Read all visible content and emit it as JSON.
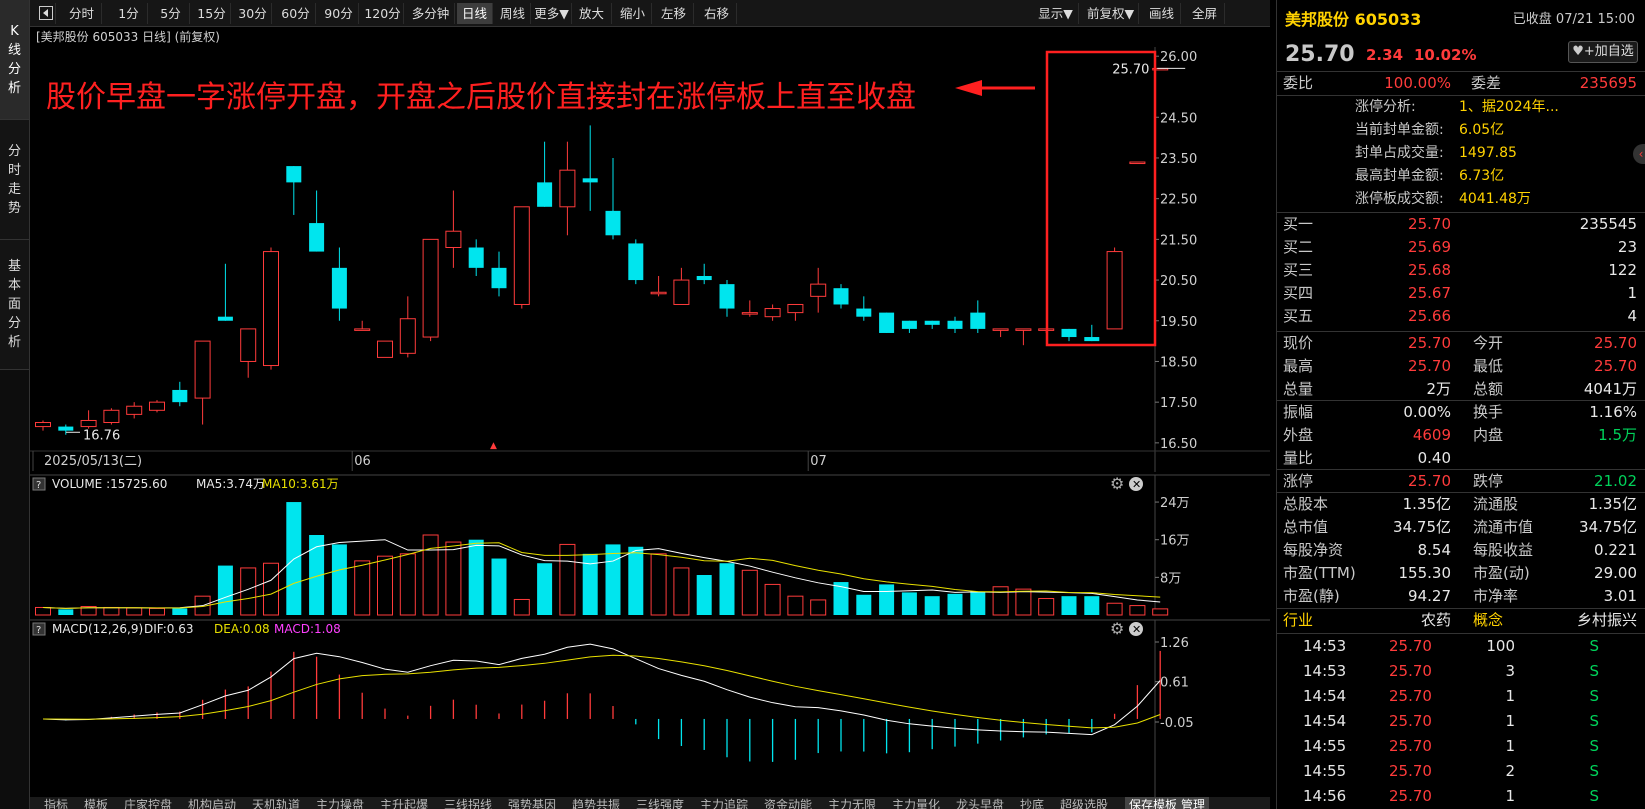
{
  "leftnav": [
    {
      "label": "K线分析",
      "active": true
    },
    {
      "label": "分时走势",
      "active": false
    },
    {
      "label": "基本面分析",
      "active": false
    }
  ],
  "toolbar": {
    "items": [
      "分时",
      "1分",
      "5分",
      "15分",
      "30分",
      "60分",
      "90分",
      "120分",
      "多分钟",
      "日线",
      "周线",
      "更多▼",
      "放大",
      "缩小",
      "左移",
      "右移"
    ],
    "active": "日线",
    "right_items": [
      "显示▼",
      "前复权▼",
      "画线",
      "全屏"
    ]
  },
  "chart_header": "[美邦股份 605033 日线] (前复权)",
  "annotation": "股价早盘一字涨停开盘，开盘之后股价直接封在涨停板上直至收盘",
  "chart_data": {
    "type": "candlestick",
    "price_axis": [
      "26.00",
      "24.50",
      "23.50",
      "22.50",
      "21.50",
      "20.50",
      "19.50",
      "18.50",
      "17.50",
      "16.50"
    ],
    "ylim": [
      16.3,
      26.3
    ],
    "date_labels": [
      {
        "i": 0,
        "text": "2025/05/13(二)"
      },
      {
        "i": 14,
        "text": "06"
      },
      {
        "i": 34,
        "text": "07"
      }
    ],
    "candles": [
      [
        16.9,
        17.0,
        16.8,
        17.05
      ],
      [
        16.9,
        16.8,
        16.7,
        16.95
      ],
      [
        16.9,
        17.05,
        16.85,
        17.3
      ],
      [
        17.0,
        17.3,
        16.95,
        17.35
      ],
      [
        17.2,
        17.4,
        17.1,
        17.5
      ],
      [
        17.3,
        17.5,
        17.25,
        17.55
      ],
      [
        17.8,
        17.5,
        17.4,
        18.0
      ],
      [
        17.6,
        19.0,
        16.95,
        19.0
      ],
      [
        19.6,
        19.5,
        19.5,
        20.9
      ],
      [
        18.5,
        19.3,
        18.1,
        19.3
      ],
      [
        18.4,
        21.2,
        18.3,
        21.3
      ],
      [
        23.3,
        22.9,
        22.1,
        23.3
      ],
      [
        21.9,
        21.2,
        21.2,
        22.7
      ],
      [
        20.8,
        19.8,
        19.5,
        21.3
      ],
      [
        19.3,
        19.3,
        19.3,
        19.5
      ],
      [
        18.6,
        19.0,
        18.6,
        19.0
      ],
      [
        18.7,
        19.55,
        18.6,
        20.1
      ],
      [
        19.1,
        21.5,
        19.0,
        21.5
      ],
      [
        21.3,
        21.7,
        20.8,
        22.7
      ],
      [
        21.3,
        20.8,
        20.6,
        21.5
      ],
      [
        20.8,
        20.3,
        20.1,
        21.2
      ],
      [
        19.9,
        22.3,
        19.8,
        22.3
      ],
      [
        22.9,
        22.3,
        22.3,
        23.9
      ],
      [
        22.3,
        23.2,
        21.6,
        23.9
      ],
      [
        23.0,
        22.9,
        22.2,
        24.3
      ],
      [
        22.2,
        21.6,
        21.5,
        23.5
      ],
      [
        21.4,
        20.5,
        20.4,
        21.5
      ],
      [
        20.2,
        20.2,
        20.1,
        20.6
      ],
      [
        19.9,
        20.5,
        19.9,
        20.8
      ],
      [
        20.6,
        20.5,
        20.4,
        20.9
      ],
      [
        20.4,
        19.8,
        19.6,
        20.5
      ],
      [
        19.7,
        19.7,
        19.6,
        20.0
      ],
      [
        19.6,
        19.8,
        19.5,
        19.9
      ],
      [
        19.7,
        19.9,
        19.5,
        19.9
      ],
      [
        20.1,
        20.4,
        19.7,
        20.8
      ],
      [
        20.3,
        19.9,
        19.8,
        20.4
      ],
      [
        19.8,
        19.6,
        19.5,
        20.1
      ],
      [
        19.7,
        19.2,
        19.2,
        19.7
      ],
      [
        19.5,
        19.3,
        19.2,
        19.5
      ],
      [
        19.5,
        19.4,
        19.3,
        19.5
      ],
      [
        19.5,
        19.3,
        19.2,
        19.6
      ],
      [
        19.7,
        19.3,
        19.2,
        20.0
      ],
      [
        19.3,
        19.3,
        19.1,
        19.3
      ],
      [
        19.3,
        19.3,
        18.9,
        19.3
      ],
      [
        19.3,
        19.3,
        19.2,
        19.3
      ],
      [
        19.3,
        19.1,
        19.0,
        19.3
      ],
      [
        19.1,
        19.0,
        19.0,
        19.4
      ],
      [
        19.3,
        21.2,
        19.3,
        21.3
      ],
      [
        23.4,
        23.4,
        23.4,
        23.4
      ],
      [
        25.7,
        25.7,
        25.7,
        25.7
      ]
    ],
    "last_price_label": "25.70",
    "low_label": "16.76",
    "volume": {
      "title": "VOLUME",
      "values_text": ":15725.60",
      "ma5_text": "MA5:3.74万",
      "ma10_text": "MA10:3.61万",
      "axis": [
        "24万",
        "16万",
        "8万"
      ],
      "max": 25.5,
      "bars": [
        1.6,
        1.2,
        1.8,
        1.6,
        1.5,
        1.4,
        1.4,
        4.0,
        10.5,
        10.0,
        11.0,
        24.0,
        17.0,
        15.0,
        11.5,
        12.5,
        13.0,
        17.0,
        15.5,
        16.0,
        12.0,
        3.3,
        11.0,
        15.0,
        13.0,
        15.0,
        14.5,
        13.0,
        10.0,
        8.5,
        11.0,
        9.5,
        6.5,
        4.0,
        3.2,
        7.0,
        4.3,
        6.5,
        4.8,
        4.0,
        4.5,
        4.8,
        6.0,
        5.5,
        3.5,
        4.0,
        4.0,
        2.5,
        2.0,
        1.3
      ]
    },
    "macd": {
      "title": "MACD(12,26,9)",
      "dif_text": "DIF:0.63",
      "dea_text": "DEA:0.08",
      "macd_text": "MACD:1.08",
      "axis": [
        "1.26",
        "0.61",
        "-0.05"
      ]
    }
  },
  "colors": {
    "up": "#ff3b3b",
    "down": "#00e5ee",
    "ma5": "#ffffff",
    "ma10": "#e8e000",
    "macd_pos": "#ff3b3b",
    "macd_neg": "#00e5ee"
  },
  "right": {
    "name_code": "美邦股份 605033",
    "status": "已收盘 07/21 15:00",
    "price": "25.70",
    "change": "2.34",
    "pct": "10.02%",
    "follow_btn": "+加自选",
    "weibi_label": "委比",
    "weibi": "100.00%",
    "weicha_label": "委差",
    "weicha": "235695",
    "limit_info": [
      {
        "label": "涨停分析:",
        "value": "1、据2024年..."
      },
      {
        "label": "当前封单金额:",
        "value": "6.05亿"
      },
      {
        "label": "封单占成交量:",
        "value": "1497.85"
      },
      {
        "label": "最高封单金额:",
        "value": "6.73亿"
      },
      {
        "label": "涨停板成交额:",
        "value": "4041.48万"
      }
    ],
    "bids": [
      {
        "label": "买一",
        "price": "25.70",
        "vol": "235545"
      },
      {
        "label": "买二",
        "price": "25.69",
        "vol": "23"
      },
      {
        "label": "买三",
        "price": "25.68",
        "vol": "122"
      },
      {
        "label": "买四",
        "price": "25.67",
        "vol": "1"
      },
      {
        "label": "买五",
        "price": "25.66",
        "vol": "4"
      }
    ],
    "quote": [
      [
        "现价",
        "25.70",
        "今开",
        "25.70"
      ],
      [
        "最高",
        "25.70",
        "最低",
        "25.70"
      ],
      [
        "总量",
        "2万",
        "总额",
        "4041万"
      ],
      [
        "振幅",
        "0.00%",
        "换手",
        "1.16%"
      ],
      [
        "外盘",
        "4609",
        "内盘",
        "1.5万"
      ],
      [
        "量比",
        "0.40",
        "",
        ""
      ],
      [
        "涨停",
        "25.70",
        "跌停",
        "21.02"
      ],
      [
        "总股本",
        "1.35亿",
        "流通股",
        "1.35亿"
      ],
      [
        "总市值",
        "34.75亿",
        "流通市值",
        "34.75亿"
      ],
      [
        "每股净资",
        "8.54",
        "每股收益",
        "0.221"
      ],
      [
        "市盈(TTM)",
        "155.30",
        "市盈(动)",
        "29.00"
      ],
      [
        "市盈(静)",
        "94.27",
        "市净率",
        "3.01"
      ]
    ],
    "industry_label": "行业",
    "industry": "农药",
    "concept_label": "概念",
    "concept": "乡村振兴",
    "ticks": [
      [
        "14:53",
        "25.70",
        "100",
        "S"
      ],
      [
        "14:53",
        "25.70",
        "3",
        "S"
      ],
      [
        "14:54",
        "25.70",
        "1",
        "S"
      ],
      [
        "14:54",
        "25.70",
        "1",
        "S"
      ],
      [
        "14:55",
        "25.70",
        "1",
        "S"
      ],
      [
        "14:55",
        "25.70",
        "2",
        "S"
      ],
      [
        "14:56",
        "25.70",
        "1",
        "S"
      ]
    ]
  },
  "bottom_tabs": [
    "指标",
    "模板",
    "庄家控盘",
    "机构启动",
    "天机轨道",
    "主力操盘",
    "主升起爆",
    "三线拐线",
    "强势基因",
    "趋势共振",
    "三线强度",
    "主力追踪",
    "资金动能",
    "主力无限",
    "主力量化",
    "龙头早盘",
    "抄底",
    "超级选股",
    "保存模板",
    "管理"
  ]
}
